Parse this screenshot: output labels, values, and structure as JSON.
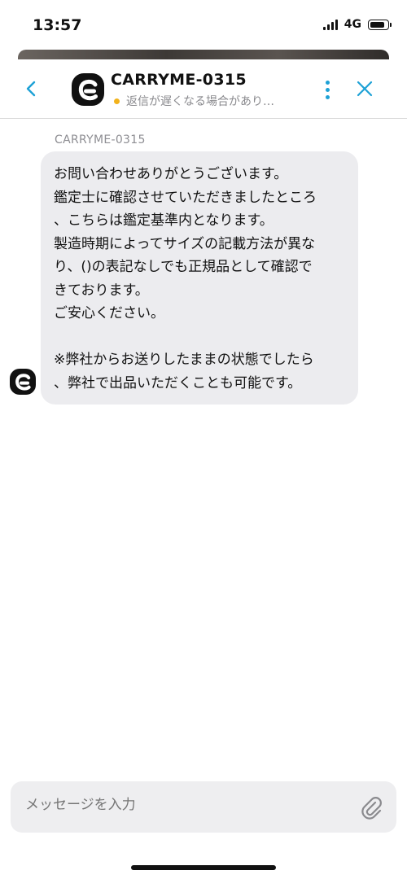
{
  "status_bar": {
    "time": "13:57",
    "network": "4G"
  },
  "header": {
    "title": "CARRYME-0315",
    "subtitle": "返信が遅くなる場合があり…",
    "status_dot_color": "#f2b21b",
    "accent_color": "#1da1d6"
  },
  "message": {
    "sender": "CARRYME-0315",
    "text": "お問い合わせありがとうございます。\n鑑定士に確認させていただきましたところ\n、こちらは鑑定基準内となります。\n製造時期によってサイズの記載方法が異な\nり、()の表記なしでも正規品として確認で\nきております。\nご安心ください。\n\n※弊社からお送りしたままの状態でしたら\n、弊社で出品いただくことも可能です。"
  },
  "composer": {
    "placeholder": "メッセージを入力"
  }
}
